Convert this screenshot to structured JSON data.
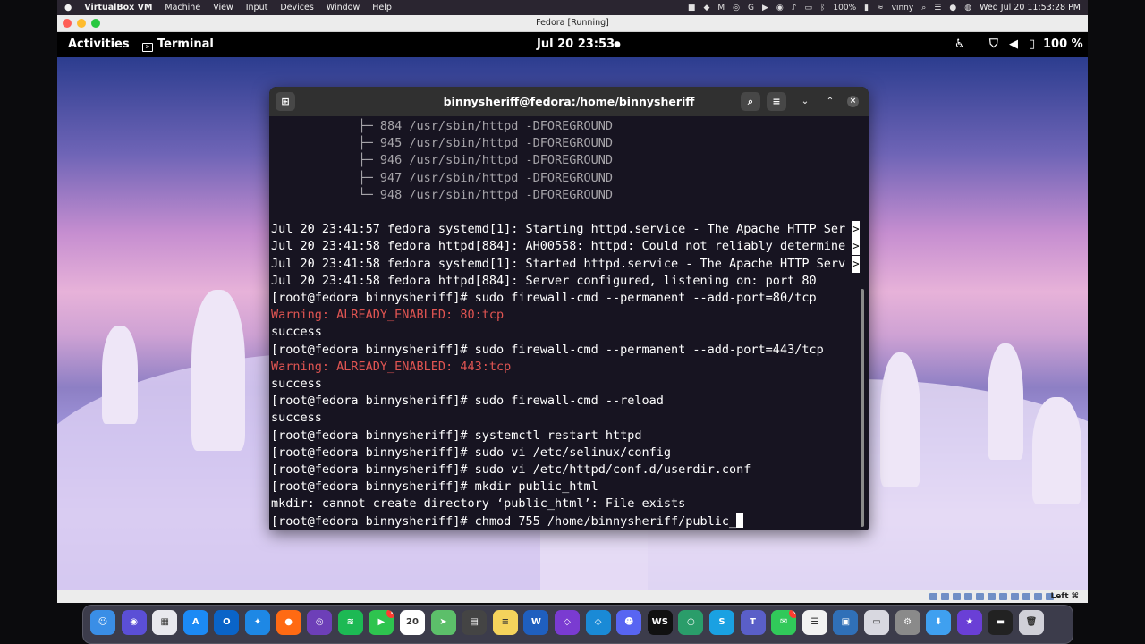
{
  "mac_menubar": {
    "apple_icon": "apple-icon",
    "app_name": "VirtualBox VM",
    "menus": [
      "Machine",
      "View",
      "Input",
      "Devices",
      "Window",
      "Help"
    ],
    "battery": "100%",
    "user": "vinny",
    "clock": "Wed Jul 20  11:53:28 PM"
  },
  "vbox_window": {
    "title": "Fedora [Running]",
    "host_key": "Left ⌘"
  },
  "gnome_bar": {
    "activities": "Activities",
    "app": "Terminal",
    "clock": "Jul 20  23:53",
    "battery": "100 %"
  },
  "terminal": {
    "title": "binnysheriff@fedora:/home/binnysheriff",
    "lines": [
      {
        "text": "            ├─ 884 /usr/sbin/httpd -DFOREGROUND",
        "style": "dim"
      },
      {
        "text": "            ├─ 945 /usr/sbin/httpd -DFOREGROUND",
        "style": "dim"
      },
      {
        "text": "            ├─ 946 /usr/sbin/httpd -DFOREGROUND",
        "style": "dim"
      },
      {
        "text": "            ├─ 947 /usr/sbin/httpd -DFOREGROUND",
        "style": "dim"
      },
      {
        "text": "            └─ 948 /usr/sbin/httpd -DFOREGROUND",
        "style": "dim"
      },
      {
        "text": "",
        "style": "normal"
      },
      {
        "text": "Jul 20 23:41:57 fedora systemd[1]: Starting httpd.service - The Apache HTTP Ser",
        "style": "normal",
        "truncated": true
      },
      {
        "text": "Jul 20 23:41:58 fedora httpd[884]: AH00558: httpd: Could not reliably determine",
        "style": "normal",
        "truncated": true
      },
      {
        "text": "Jul 20 23:41:58 fedora systemd[1]: Started httpd.service - The Apache HTTP Serv",
        "style": "normal",
        "truncated": true
      },
      {
        "text": "Jul 20 23:41:58 fedora httpd[884]: Server configured, listening on: port 80",
        "style": "normal"
      },
      {
        "text": "[root@fedora binnysheriff]# sudo firewall-cmd --permanent --add-port=80/tcp",
        "style": "normal"
      },
      {
        "text": "Warning: ALREADY_ENABLED: 80:tcp",
        "style": "warn"
      },
      {
        "text": "success",
        "style": "normal"
      },
      {
        "text": "[root@fedora binnysheriff]# sudo firewall-cmd --permanent --add-port=443/tcp",
        "style": "normal"
      },
      {
        "text": "Warning: ALREADY_ENABLED: 443:tcp",
        "style": "warn"
      },
      {
        "text": "success",
        "style": "normal"
      },
      {
        "text": "[root@fedora binnysheriff]# sudo firewall-cmd --reload",
        "style": "normal"
      },
      {
        "text": "success",
        "style": "normal"
      },
      {
        "text": "[root@fedora binnysheriff]# systemctl restart httpd",
        "style": "normal"
      },
      {
        "text": "[root@fedora binnysheriff]# sudo vi /etc/selinux/config",
        "style": "normal"
      },
      {
        "text": "[root@fedora binnysheriff]# sudo vi /etc/httpd/conf.d/userdir.conf",
        "style": "normal"
      },
      {
        "text": "[root@fedora binnysheriff]# mkdir public_html",
        "style": "normal"
      },
      {
        "text": "mkdir: cannot create directory ‘public_html’: File exists",
        "style": "normal"
      },
      {
        "text": "[root@fedora binnysheriff]# chmod 755 /home/binnysheriff/public_",
        "style": "normal",
        "cursor": true
      }
    ],
    "truncation_marker": ">"
  },
  "dock": {
    "items": [
      {
        "name": "finder-icon",
        "color": "#3a8ee6",
        "glyph": "☺"
      },
      {
        "name": "siri-icon",
        "color": "#5b4fd6",
        "glyph": "◉"
      },
      {
        "name": "launchpad-icon",
        "color": "#e8e8ee",
        "glyph": "▦"
      },
      {
        "name": "app-store-icon",
        "color": "#1c8af5",
        "glyph": "A"
      },
      {
        "name": "outlook-icon",
        "color": "#0a64c8",
        "glyph": "O"
      },
      {
        "name": "safari-icon",
        "color": "#1e88e5",
        "glyph": "✦"
      },
      {
        "name": "firefox-icon",
        "color": "#ff6a13",
        "glyph": "●"
      },
      {
        "name": "tor-browser-icon",
        "color": "#6d3fb8",
        "glyph": "◎"
      },
      {
        "name": "spotify-icon",
        "color": "#1db954",
        "glyph": "≋"
      },
      {
        "name": "facetime-icon",
        "color": "#2ec44f",
        "glyph": "▶",
        "badge": "1"
      },
      {
        "name": "calendar-icon",
        "color": "#ffffff",
        "glyph": "20"
      },
      {
        "name": "maps-icon",
        "color": "#5cbf6a",
        "glyph": "➤"
      },
      {
        "name": "calculator-icon",
        "color": "#444444",
        "glyph": "▤"
      },
      {
        "name": "notes-icon",
        "color": "#f5d35c",
        "glyph": "≡"
      },
      {
        "name": "word-icon",
        "color": "#1f5fbf",
        "glyph": "W"
      },
      {
        "name": "visual-studio-icon",
        "color": "#7a3bd1",
        "glyph": "◇"
      },
      {
        "name": "vscode-icon",
        "color": "#1a8ad6",
        "glyph": "◇"
      },
      {
        "name": "discord-icon",
        "color": "#5865f2",
        "glyph": "☻"
      },
      {
        "name": "webstorm-icon",
        "color": "#111111",
        "glyph": "WS"
      },
      {
        "name": "chatgpt-icon",
        "color": "#2a9d6a",
        "glyph": "○"
      },
      {
        "name": "skype-icon",
        "color": "#1aa1e2",
        "glyph": "S"
      },
      {
        "name": "teams-icon",
        "color": "#5a5fc8",
        "glyph": "T"
      },
      {
        "name": "messages-icon",
        "color": "#31c95a",
        "glyph": "✉",
        "badge": "5"
      },
      {
        "name": "reminders-icon",
        "color": "#f2f2f2",
        "glyph": "☰"
      },
      {
        "name": "virtualbox-icon",
        "color": "#3070b8",
        "glyph": "▣"
      },
      {
        "name": "preview-icon",
        "color": "#d8d8e0",
        "glyph": "▭"
      },
      {
        "name": "system-settings-icon",
        "color": "#8a8a8a",
        "glyph": "⚙"
      },
      {
        "name": "downloads-folder-icon",
        "color": "#3fa0f0",
        "glyph": "⬇"
      },
      {
        "name": "imovie-icon",
        "color": "#6a3fd6",
        "glyph": "★"
      },
      {
        "name": "screenshot-thumbnail-icon",
        "color": "#222222",
        "glyph": "▬"
      },
      {
        "name": "trash-icon",
        "color": "#d0d0d8",
        "glyph": "🗑"
      }
    ]
  }
}
